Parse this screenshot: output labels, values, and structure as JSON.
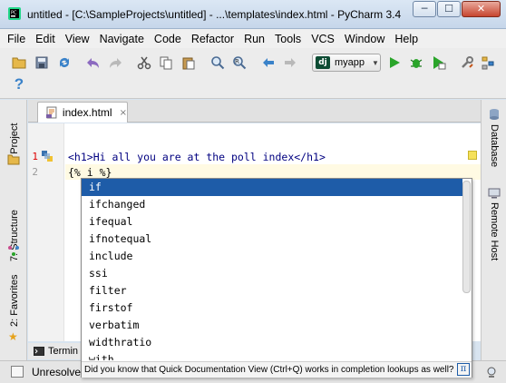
{
  "window": {
    "title": "untitled - [C:\\SampleProjects\\untitled] - ...\\templates\\index.html - PyCharm 3.4",
    "minimize_glyph": "─",
    "maximize_glyph": "☐",
    "close_glyph": "✕"
  },
  "menu": [
    "File",
    "Edit",
    "View",
    "Navigate",
    "Code",
    "Refactor",
    "Run",
    "Tools",
    "VCS",
    "Window",
    "Help"
  ],
  "toolbar": {
    "run_config_badge": "dj",
    "run_config_label": "myapp",
    "help_glyph": "?",
    "icons": [
      "open-folder-icon",
      "save-icon",
      "sync-icon",
      "undo-icon",
      "redo-icon",
      "cut-icon",
      "copy-icon",
      "paste-icon",
      "find-icon",
      "replace-icon",
      "back-icon",
      "forward-icon",
      "run-icon",
      "debug-icon",
      "coverage-icon",
      "settings-icon",
      "structure-icon"
    ]
  },
  "left_tool_windows": [
    "1: Project",
    "7: Structure",
    "2: Favorites"
  ],
  "right_tool_windows": [
    "Database",
    "Remote Host"
  ],
  "editor": {
    "tab_label": "index.html",
    "tab_close": "×",
    "line_numbers": [
      "1",
      "2"
    ],
    "lines": [
      "<h1>Hi all you are at the poll index</h1>",
      "{% i %}"
    ]
  },
  "completion": {
    "items": [
      "if",
      "ifchanged",
      "ifequal",
      "ifnotequal",
      "include",
      "ssi",
      "filter",
      "firstof",
      "verbatim",
      "widthratio",
      "with"
    ],
    "selected_index": 0,
    "hint": "Did you know that Quick Documentation View (Ctrl+Q) works in completion lookups as well?",
    "hint_icon": "π"
  },
  "bottom_tab": "Termin",
  "status": {
    "text": "Unresolve"
  }
}
